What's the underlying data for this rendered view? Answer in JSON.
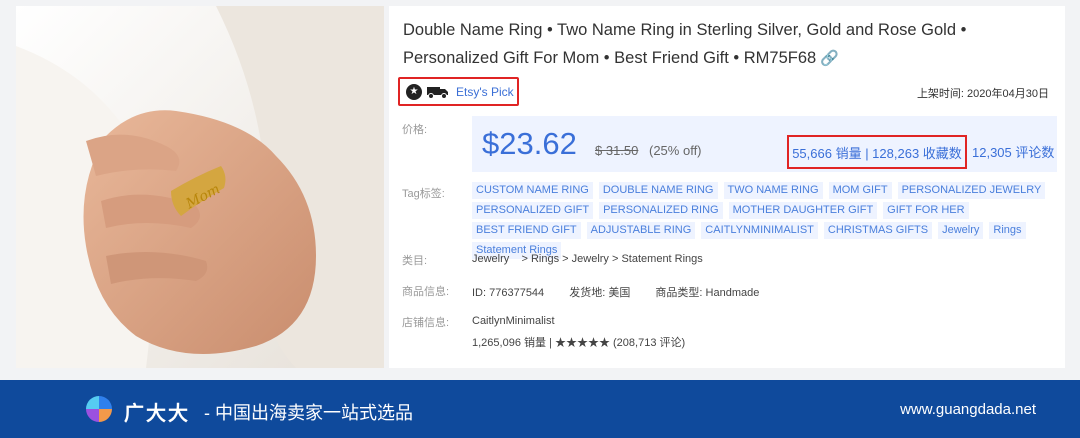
{
  "product": {
    "title": "Double Name Ring • Two Name Ring in Sterling Silver, Gold and Rose Gold • Personalized Gift For Mom • Best Friend Gift • RM75F68",
    "link_icon": "link-icon",
    "etsy_pick": "Etsy's Pick",
    "listed_date": "上架时间: 2020年04月30日"
  },
  "labels": {
    "price": "价格:",
    "tags": "Tag标签:",
    "category": "类目:",
    "product_info": "商品信息:",
    "store_info": "店铺信息:"
  },
  "price": {
    "current": "$23.62",
    "original": "$ 31.50",
    "discount": "(25% off)",
    "sales_favorites": "55,666 销量 | 128,263 收藏数",
    "reviews": "12,305 评论数"
  },
  "tags": [
    "CUSTOM NAME RING",
    "DOUBLE NAME RING",
    "TWO NAME RING",
    "MOM GIFT",
    "PERSONALIZED JEWELRY",
    "PERSONALIZED GIFT",
    "PERSONALIZED RING",
    "MOTHER DAUGHTER GIFT",
    "GIFT FOR HER",
    "BEST FRIEND GIFT",
    "ADJUSTABLE RING",
    "CAITLYNMINIMALIST",
    "CHRISTMAS GIFTS",
    "Jewelry",
    "Rings",
    "Statement Rings"
  ],
  "category": "Jewelry    > Rings > Jewelry > Statement Rings",
  "product_info": {
    "id": "ID: 776377544",
    "ship_from": "发货地: 美国",
    "type": "商品类型: Handmade"
  },
  "store": {
    "name": "CaitlynMinimalist",
    "stats": "1,265,096 销量 | ★★★★★ (208,713 评论)"
  },
  "banner": {
    "brand": "广大大",
    "slogan": "- 中国出海卖家一站式选品",
    "site": "www.guangdada.net"
  },
  "colors": {
    "accent": "#3a6fd8",
    "highlight_border": "#e02424",
    "banner": "#0f4a9c"
  }
}
